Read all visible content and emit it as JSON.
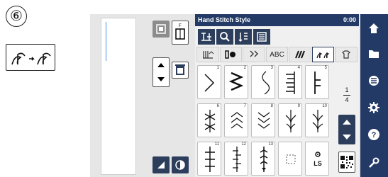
{
  "step": {
    "number": "⑥"
  },
  "panel": {
    "title": "Hand Stitch Style",
    "time": "0:00"
  },
  "tabs": [
    {
      "label": "⫼",
      "icon": "straight-stitch-tab-icon"
    },
    {
      "label": "⦀",
      "icon": "buttonhole-tab-icon"
    },
    {
      "label": "✣",
      "icon": "decorative-tab-icon"
    },
    {
      "label": "ABC",
      "icon": "alphabet-tab-icon"
    },
    {
      "label": "⌗",
      "icon": "satin-tab-icon"
    },
    {
      "label": "✿",
      "icon": "hand-stitch-tab-icon",
      "active": true
    },
    {
      "label": "⌂",
      "icon": "heirloom-tab-icon"
    }
  ],
  "stitches": [
    {
      "num": "1",
      "glyph": "zigzag-single"
    },
    {
      "num": "2",
      "glyph": "zigzag-double"
    },
    {
      "num": "3",
      "glyph": "wave"
    },
    {
      "num": "4",
      "glyph": "blanket"
    },
    {
      "num": "5",
      "glyph": "L-stitch"
    },
    {
      "num": "6",
      "glyph": "star"
    },
    {
      "num": "7",
      "glyph": "chevron-up"
    },
    {
      "num": "8",
      "glyph": "chevron-down"
    },
    {
      "num": "9",
      "glyph": "feather"
    },
    {
      "num": "10",
      "glyph": "feather-right"
    },
    {
      "num": "11",
      "glyph": "cross-line"
    },
    {
      "num": "12",
      "glyph": "cross-offset"
    },
    {
      "num": "13",
      "glyph": "cross-arrow"
    },
    {
      "num": "",
      "glyph": "dotted-square"
    },
    {
      "num": "",
      "glyph": "LS"
    },
    {
      "num": "",
      "glyph": "qr"
    }
  ],
  "pager": {
    "current": "1",
    "total": "4"
  },
  "ls_label": "LS",
  "abc_label": "ABC",
  "sidebar": [
    {
      "icon": "home-icon"
    },
    {
      "icon": "folder-icon"
    },
    {
      "icon": "list-icon"
    },
    {
      "icon": "settings-icon"
    },
    {
      "icon": "help-icon"
    },
    {
      "icon": "tools-icon"
    }
  ],
  "colors": {
    "title_bar": "#243a66",
    "button_dark": "#2c3e5c",
    "panel_bg": "#f0f0f0"
  }
}
